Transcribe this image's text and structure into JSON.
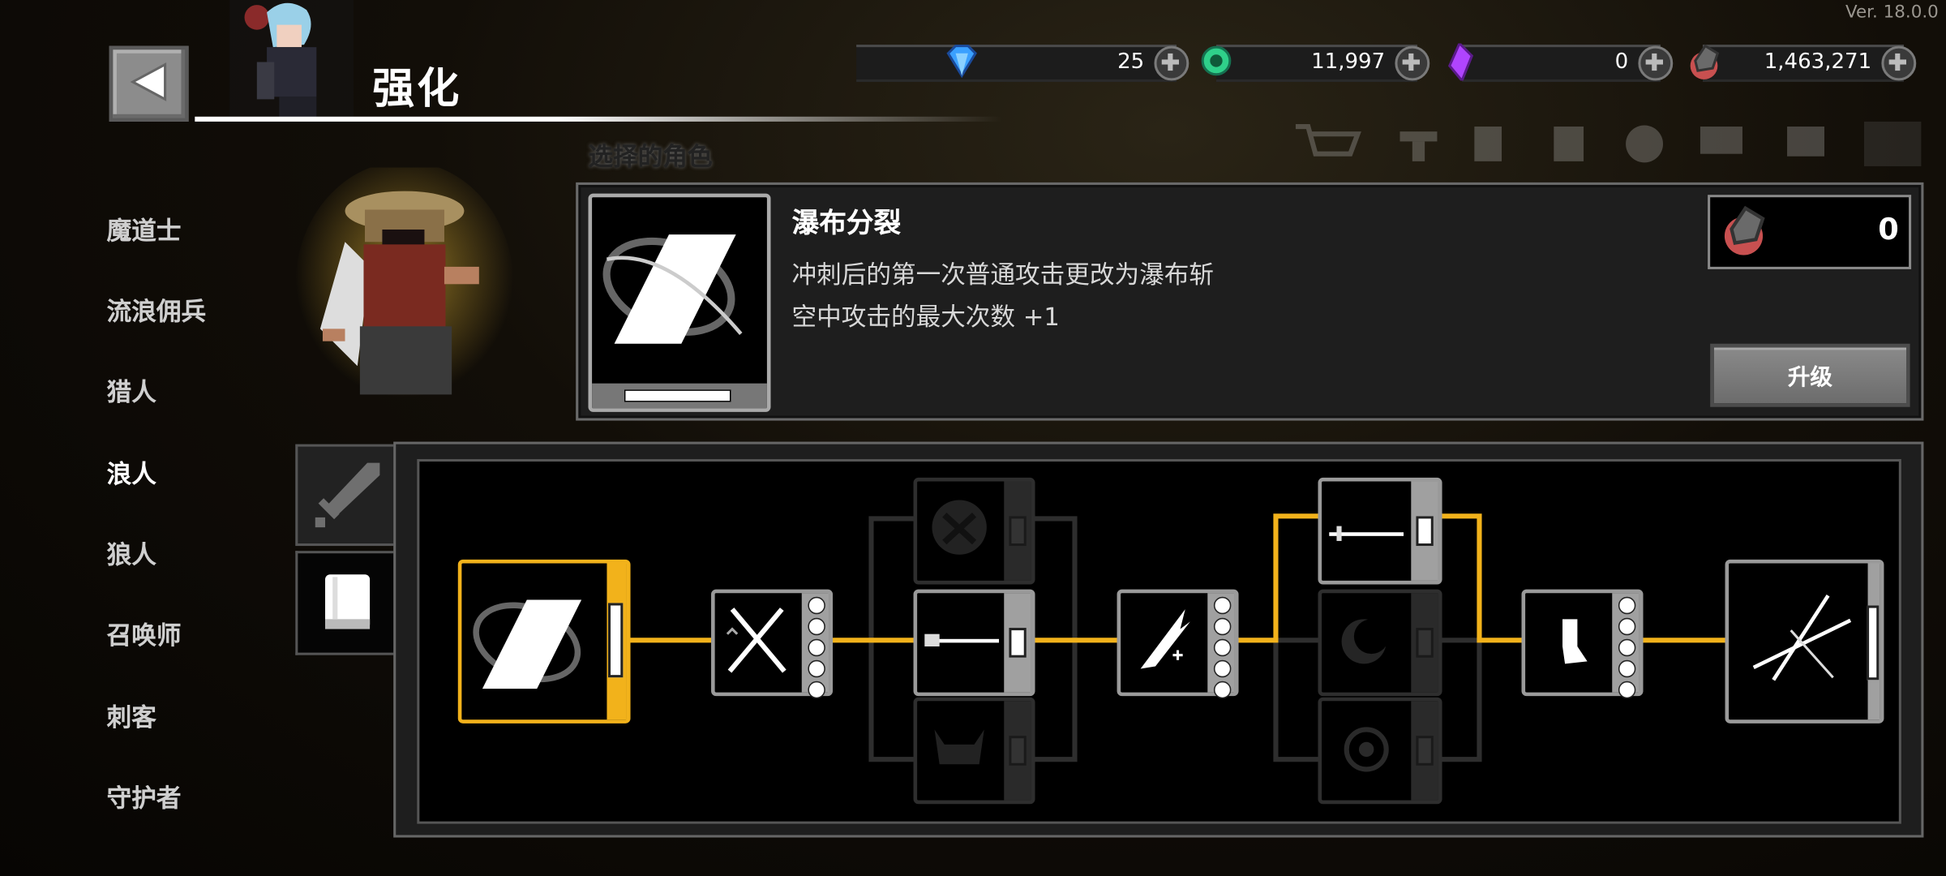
{
  "version": "Ver. 18.0.0",
  "header": {
    "title": "强化",
    "subheading": "选择的角色"
  },
  "resources": [
    {
      "name": "blue-gem",
      "value": "25",
      "color": "#3aa0ff"
    },
    {
      "name": "green-coin",
      "value": "11,997",
      "color": "#2fd08a"
    },
    {
      "name": "purple-crystal",
      "value": "0",
      "color": "#b044ff"
    },
    {
      "name": "ore-soul",
      "value": "1,463,271",
      "color": "#c85050"
    }
  ],
  "sidebar": {
    "items": [
      {
        "label": "魔道士"
      },
      {
        "label": "流浪佣兵"
      },
      {
        "label": "猎人"
      },
      {
        "label": "浪人",
        "active": true
      },
      {
        "label": "狼人"
      },
      {
        "label": "召唤师"
      },
      {
        "label": "刺客"
      },
      {
        "label": "守护者"
      }
    ]
  },
  "skill": {
    "name": "瀑布分裂",
    "description": [
      "冲刺后的第一次普通攻击更改为瀑布斩",
      "空中攻击的最大次数 +1"
    ],
    "cost": "0",
    "upgrade_label": "升级"
  },
  "tabs": [
    {
      "name": "weapon-tab",
      "icon": "sword-icon"
    },
    {
      "name": "skill-book-tab",
      "icon": "book-icon",
      "active": true
    }
  ],
  "tree": {
    "accent_color": "#f2b21b",
    "nodes": [
      {
        "id": "waterfall-split",
        "icon": "waterfall-slash-icon",
        "state": "selected"
      },
      {
        "id": "dual-swords",
        "icon": "crossed-swords-icon",
        "state": "unlocked",
        "dots": 5
      },
      {
        "id": "demon-mask",
        "icon": "demon-mask-icon",
        "state": "locked"
      },
      {
        "id": "katana-thrust",
        "icon": "katana-icon",
        "state": "unlocked"
      },
      {
        "id": "horned-helm",
        "icon": "horned-helm-icon",
        "state": "locked"
      },
      {
        "id": "blade-upgrade",
        "icon": "flaming-blade-icon",
        "state": "unlocked",
        "dots": 5
      },
      {
        "id": "long-sword",
        "icon": "long-sword-icon",
        "state": "unlocked"
      },
      {
        "id": "crescent",
        "icon": "crescent-icon",
        "state": "locked"
      },
      {
        "id": "vortex",
        "icon": "vortex-icon",
        "state": "locked"
      },
      {
        "id": "dash-boot",
        "icon": "boot-icon",
        "state": "unlocked",
        "dots": 5
      },
      {
        "id": "cross-slash",
        "icon": "cross-slash-icon",
        "state": "unlocked"
      }
    ]
  }
}
